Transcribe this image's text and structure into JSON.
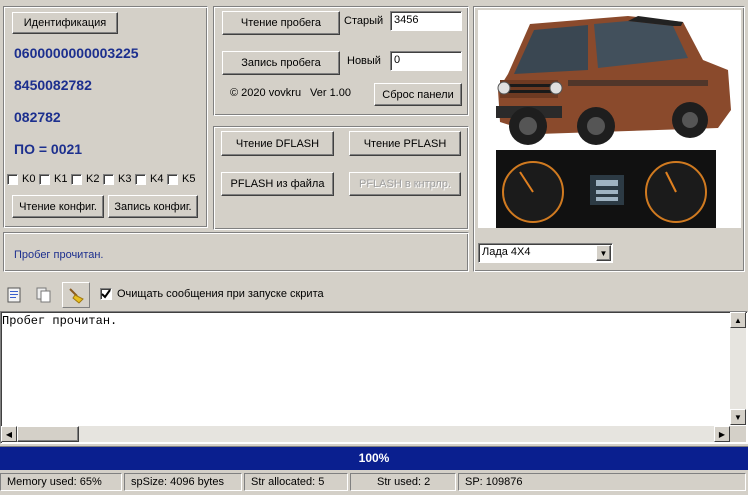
{
  "left_panel": {
    "identify_button": "Идентификация",
    "id_values": [
      "0600000000003225",
      "8450082782",
      "082782",
      "ПО = 0021"
    ],
    "checkboxes": [
      "K0",
      "K1",
      "K2",
      "K3",
      "K4",
      "K5"
    ],
    "read_config_button": "Чтение конфиг.",
    "write_config_button": "Запись конфиг."
  },
  "mileage_panel": {
    "read_button": "Чтение пробега",
    "old_label": "Старый",
    "old_value": "3456",
    "write_button": "Запись пробега",
    "new_label": "Новый",
    "new_value": "0",
    "copyright": "© 2020 vovkru",
    "version": "Ver 1.00",
    "reset_button": "Сброс панели"
  },
  "flash_panel": {
    "read_dflash": "Чтение DFLASH",
    "read_pflash": "Чтение PFLASH",
    "pflash_from_file": "PFLASH из файла",
    "pflash_to_controller": "PFLASH в кнтрлр."
  },
  "message_panel": {
    "text": "Пробег прочитан."
  },
  "model_select": {
    "value": "Лада 4X4"
  },
  "toolbar": {
    "clear_checkbox_label": "Очищать сообщения при запуске скрита",
    "clear_checked": true
  },
  "log": {
    "text": "Пробег прочитан."
  },
  "progress": {
    "label": "100%",
    "value": 100
  },
  "statusbar": {
    "memory": "Memory used: 65%",
    "spsize": "spSize: 4096 bytes",
    "str_allocated": "Str allocated: 5",
    "str_used": "Str used: 2",
    "sp": "SP: 109876"
  },
  "colors": {
    "value_blue": "#1c2f8e",
    "progress_bar": "#0a1f8f",
    "car_brown": "#8a4a2c"
  }
}
